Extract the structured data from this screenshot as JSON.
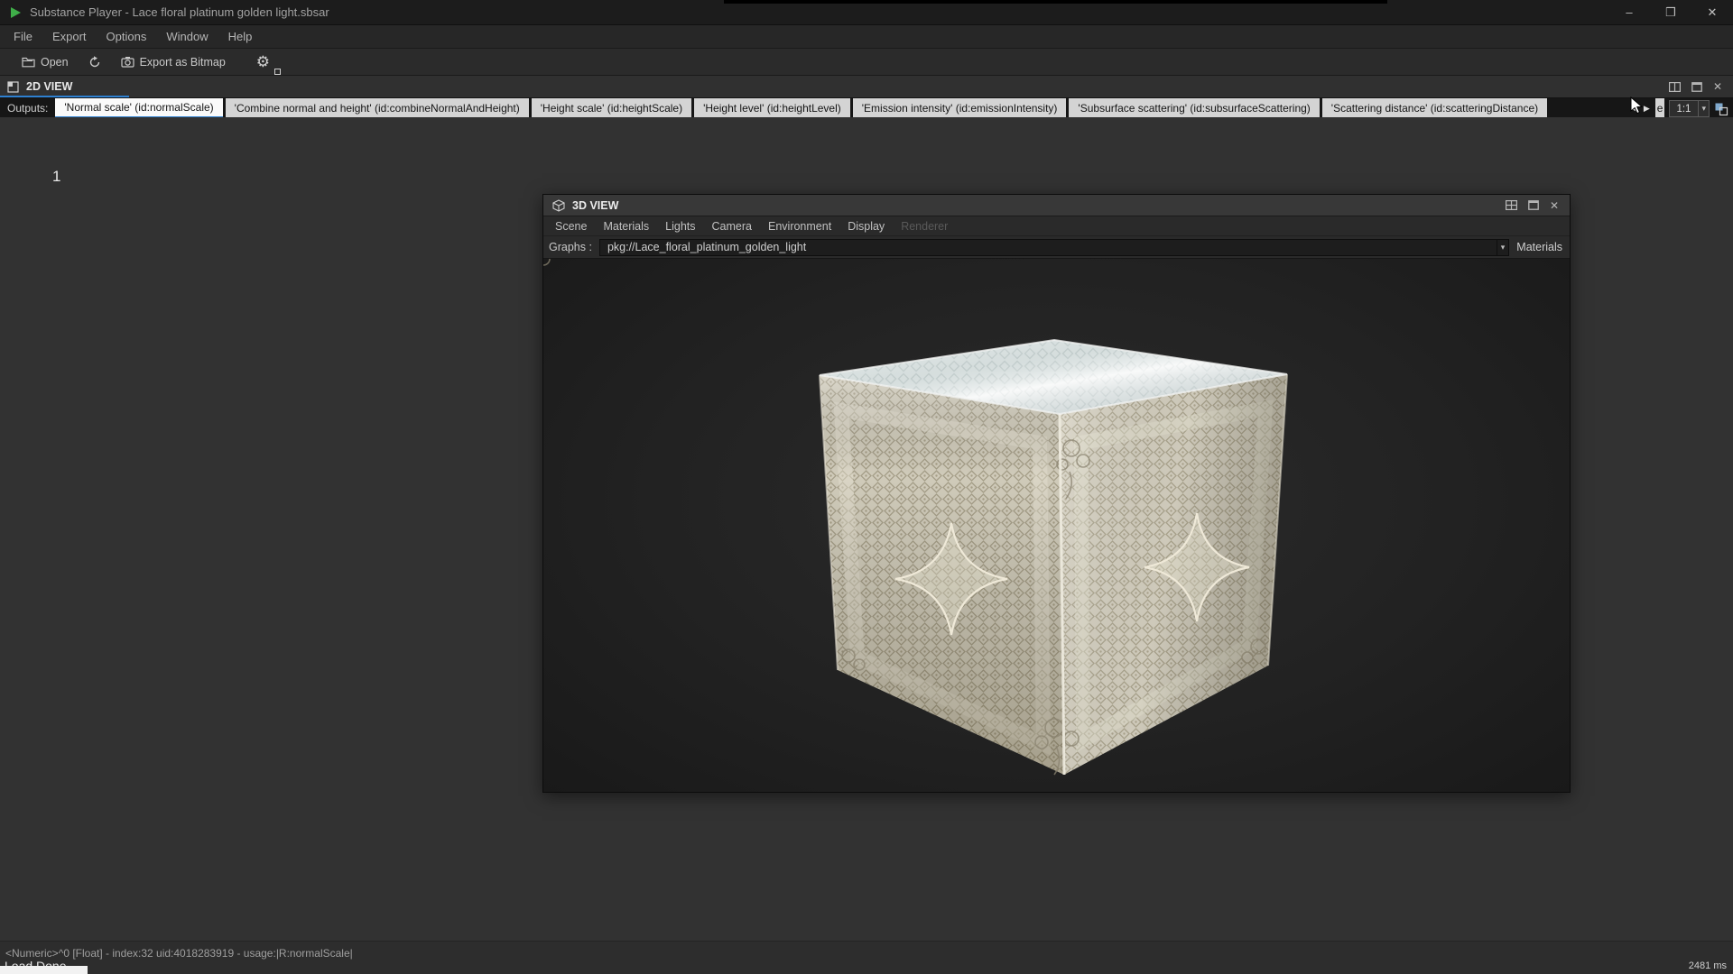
{
  "window": {
    "title": "Substance Player - Lace floral platinum golden light.sbsar"
  },
  "menubar": {
    "items": [
      "File",
      "Export",
      "Options",
      "Window",
      "Help"
    ]
  },
  "toolbar": {
    "open_label": "Open",
    "export_bitmap_label": "Export as Bitmap"
  },
  "view2d": {
    "title": "2D VIEW",
    "outputs_label": "Outputs:",
    "tabs": [
      {
        "label": "'Normal scale' (id:normalScale)",
        "selected": true
      },
      {
        "label": "'Combine normal and height' (id:combineNormalAndHeight)",
        "selected": false
      },
      {
        "label": "'Height scale' (id:heightScale)",
        "selected": false
      },
      {
        "label": "'Height level' (id:heightLevel)",
        "selected": false
      },
      {
        "label": "'Emission intensity' (id:emissionIntensity)",
        "selected": false
      },
      {
        "label": "'Subsurface scattering' (id:subsurfaceScattering)",
        "selected": false
      },
      {
        "label": "'Scattering distance' (id:scatteringDistance)",
        "selected": false
      }
    ],
    "overflow_tab_label": "e",
    "zoom_level": "1:1",
    "canvas_value": "1"
  },
  "view3d": {
    "title": "3D VIEW",
    "menu": [
      "Scene",
      "Materials",
      "Lights",
      "Camera",
      "Environment",
      "Display",
      "Renderer"
    ],
    "graphs_label": "Graphs :",
    "graph_value": "pkg://Lace_floral_platinum_golden_light",
    "materials_label": "Materials"
  },
  "statusbar": {
    "info": "<Numeric>^0 [Float] - index:32 uid:4018283919 - usage:|R:normalScale|",
    "load_status": "Load Done.",
    "render_time": "2481 ms"
  },
  "icons": {
    "minimize": "–",
    "maximize": "❒",
    "close": "✕",
    "arrow_left": "◀",
    "arrow_right": "▶",
    "chevron_down": "▾",
    "gear": "⚙"
  },
  "colors": {
    "accent": "#2e80d0",
    "titlebar_bg": "#1c1c1c",
    "tab_bg": "#d4d4d4",
    "tab_selected_bg": "#fafafa",
    "canvas_bg": "#323232",
    "viewport_bg": "#1f1f1f"
  }
}
